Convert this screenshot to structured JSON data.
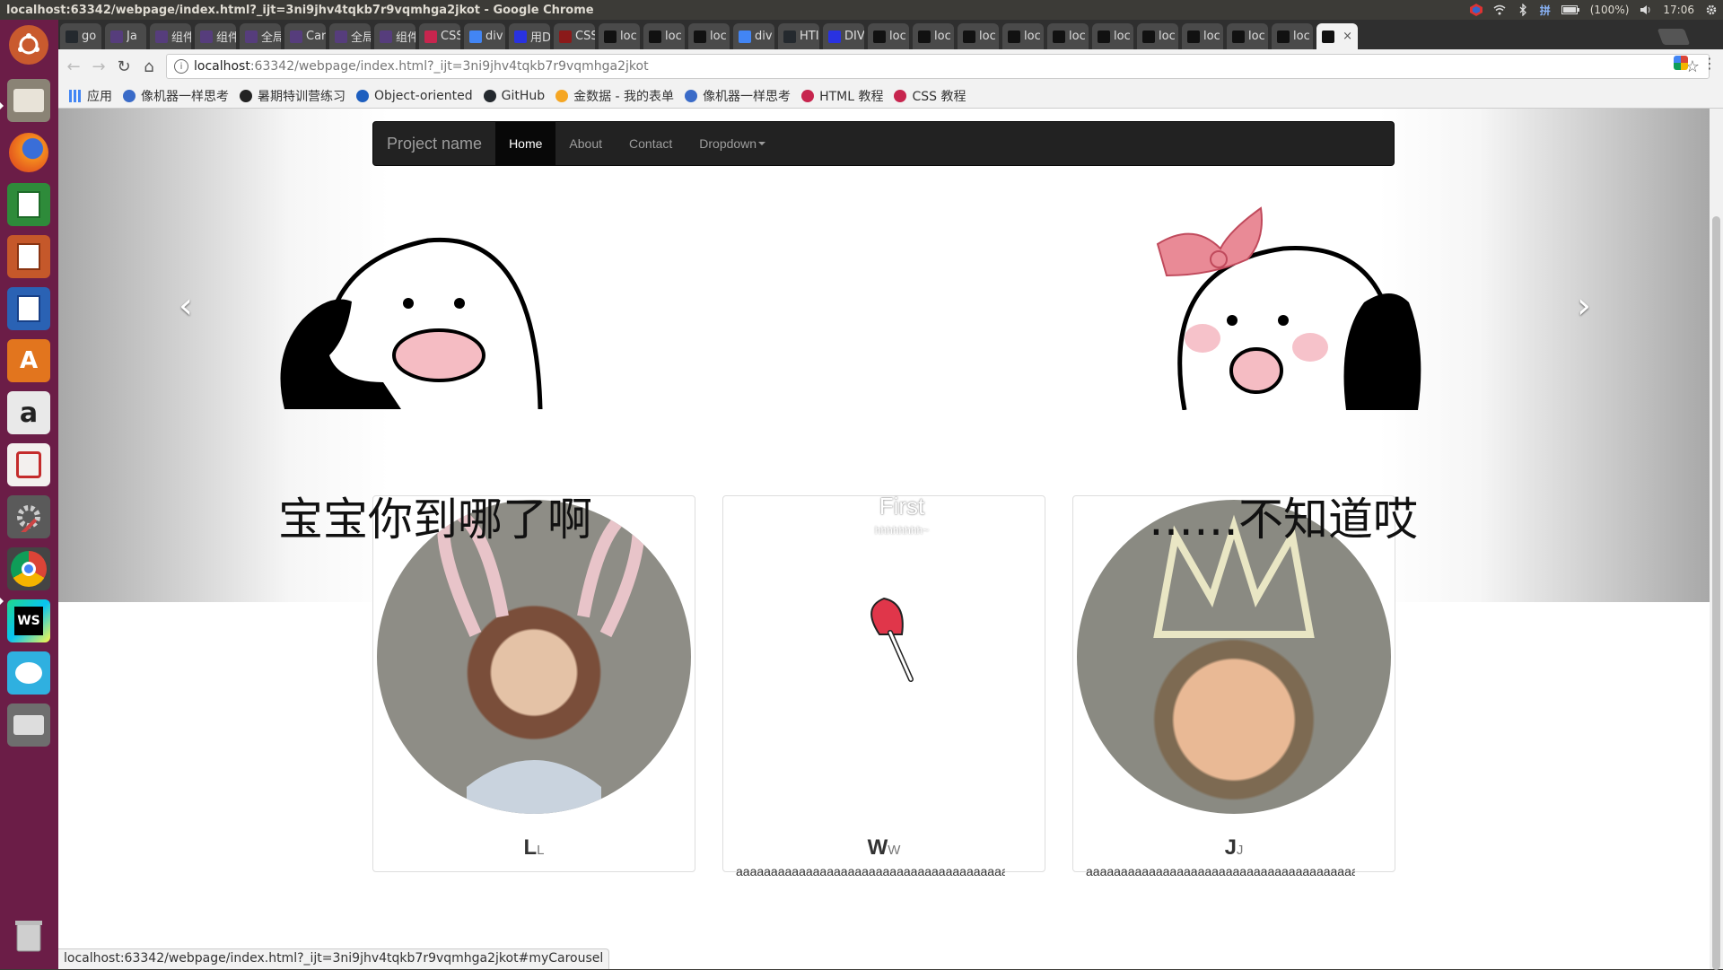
{
  "window": {
    "title": "localhost:63342/webpage/index.html?_ijt=3ni9jhv4tqkb7r9vqmhga2jkot - Google Chrome",
    "tray": {
      "battery": "(100%)",
      "clock": "17:06"
    }
  },
  "tabs": [
    {
      "label": "go",
      "icon": "github-icon",
      "color": "#24292e"
    },
    {
      "label": "Ja",
      "icon": "bootstrap-icon",
      "color": "#563d7c"
    },
    {
      "label": "组件",
      "icon": "bootstrap-icon",
      "color": "#563d7c"
    },
    {
      "label": "组件",
      "icon": "bootstrap-icon",
      "color": "#563d7c"
    },
    {
      "label": "全局",
      "icon": "bootstrap-icon",
      "color": "#563d7c"
    },
    {
      "label": "Car",
      "icon": "bootstrap-icon",
      "color": "#563d7c"
    },
    {
      "label": "全局",
      "icon": "bootstrap-icon",
      "color": "#563d7c"
    },
    {
      "label": "组件",
      "icon": "bootstrap-icon",
      "color": "#563d7c"
    },
    {
      "label": "CSS",
      "icon": "w3school-icon",
      "color": "#c7254e"
    },
    {
      "label": "div",
      "icon": "google-icon",
      "color": "#4285f4"
    },
    {
      "label": "用D",
      "icon": "baidu-icon",
      "color": "#2932e1"
    },
    {
      "label": "CSS",
      "icon": "css-icon",
      "color": "#8b1a1a"
    },
    {
      "label": "loc",
      "icon": "webstorm-icon",
      "color": "#111"
    },
    {
      "label": "loc",
      "icon": "webstorm-icon",
      "color": "#111"
    },
    {
      "label": "loc",
      "icon": "webstorm-icon",
      "color": "#111"
    },
    {
      "label": "div",
      "icon": "google-icon",
      "color": "#4285f4"
    },
    {
      "label": "HTI",
      "icon": "github-icon",
      "color": "#24292e"
    },
    {
      "label": "DIV",
      "icon": "baidu-icon",
      "color": "#2932e1"
    },
    {
      "label": "loc",
      "icon": "webstorm-icon",
      "color": "#111"
    },
    {
      "label": "loc",
      "icon": "webstorm-icon",
      "color": "#111"
    },
    {
      "label": "loc",
      "icon": "webstorm-icon",
      "color": "#111"
    },
    {
      "label": "loc",
      "icon": "webstorm-icon",
      "color": "#111"
    },
    {
      "label": "loc",
      "icon": "webstorm-icon",
      "color": "#111"
    },
    {
      "label": "loc",
      "icon": "webstorm-icon",
      "color": "#111"
    },
    {
      "label": "loc",
      "icon": "webstorm-icon",
      "color": "#111"
    },
    {
      "label": "loc",
      "icon": "webstorm-icon",
      "color": "#111"
    },
    {
      "label": "loc",
      "icon": "webstorm-icon",
      "color": "#111"
    },
    {
      "label": "loc",
      "icon": "webstorm-icon",
      "color": "#111"
    },
    {
      "label": "",
      "icon": "webstorm-icon",
      "color": "#111",
      "active": true
    }
  ],
  "toolbar": {
    "url_host": "localhost",
    "url_rest": ":63342/webpage/index.html?_ijt=3ni9jhv4tqkb7r9vqmhga2jkot"
  },
  "bookmarks": [
    {
      "label": "应用",
      "icon": "apps-icon",
      "color": "#4285f4"
    },
    {
      "label": "像机器一样思考",
      "icon": "site-icon",
      "color": "#3a6bc8"
    },
    {
      "label": "暑期特训营练习",
      "icon": "site-icon",
      "color": "#222"
    },
    {
      "label": "Object-oriented",
      "icon": "site-icon",
      "color": "#1e5fbf"
    },
    {
      "label": "GitHub",
      "icon": "github-icon",
      "color": "#24292e"
    },
    {
      "label": "金数据 - 我的表单",
      "icon": "site-icon",
      "color": "#f5a623"
    },
    {
      "label": "像机器一样思考",
      "icon": "site-icon",
      "color": "#3a6bc8"
    },
    {
      "label": "HTML 教程",
      "icon": "w3school-icon",
      "color": "#c7254e"
    },
    {
      "label": "CSS 教程",
      "icon": "w3school-icon",
      "color": "#c7254e"
    }
  ],
  "page": {
    "navbar": {
      "brand": "Project name",
      "links": [
        "Home",
        "About",
        "Contact",
        "Dropdown"
      ]
    },
    "carousel": {
      "left_caption": "宝宝你到哪了啊",
      "right_caption": "……不知道哎",
      "slide_title": "First",
      "slide_sub": "hhhhhhhh~"
    },
    "thumbnails": [
      {
        "name": "L",
        "small": "L",
        "text": ""
      },
      {
        "name": "W",
        "small": "W",
        "text": "aaaaaaaaaaaaaaaaaaaaaaaaaaaaaaaaaaaaaaaaaaaaa"
      },
      {
        "name": "J",
        "small": "J",
        "text": "aaaaaaaaaaaaaaaaaaaaaaaaaaaaaaaaaaaaaaaaaaa"
      }
    ]
  },
  "status_url": "localhost:63342/webpage/index.html?_ijt=3ni9jhv4tqkb7r9vqmhga2jkot#myCarousel"
}
